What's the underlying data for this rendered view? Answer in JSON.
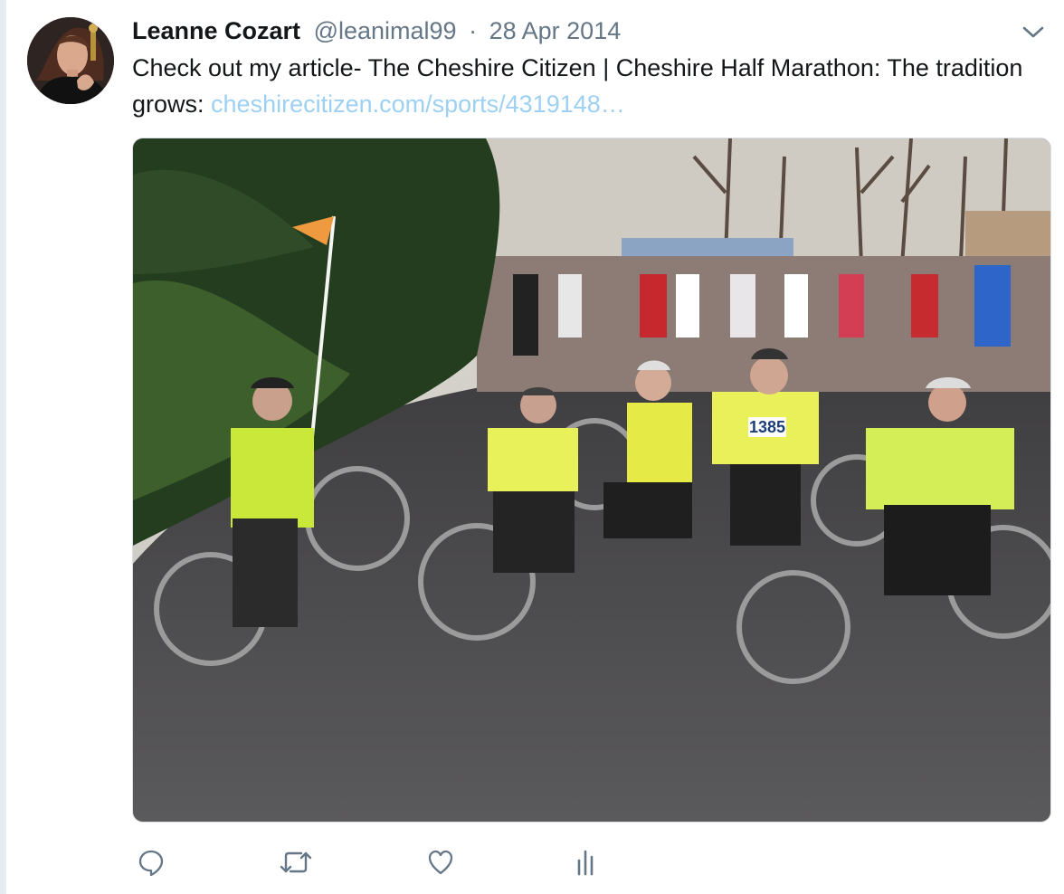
{
  "tweet": {
    "author_name": "Leanne Cozart",
    "handle": "@leanimal99",
    "separator": "·",
    "date": "28 Apr 2014",
    "text": "Check out my article- The Cheshire Citizen | Cheshire Half Marathon: The tradition grows: ",
    "link_text": "cheshirecitizen.com/sports/4319148…",
    "race_bib": "1385"
  },
  "icons": {
    "menu": "chevron-down-icon",
    "reply": "reply-icon",
    "retweet": "retweet-icon",
    "like": "heart-icon",
    "analytics": "analytics-icon"
  },
  "colors": {
    "name": "#14171a",
    "meta": "#657786",
    "link": "#9dd0f2",
    "icon": "#657786",
    "divider": "#e6ecf0"
  }
}
